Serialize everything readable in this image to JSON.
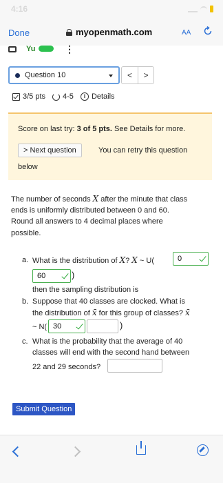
{
  "status": {
    "time": "4:16"
  },
  "browser": {
    "done": "Done",
    "url": "myopenmath.com",
    "text_size": "AA"
  },
  "toolbar": {
    "fragment": "Yu"
  },
  "nav": {
    "question": "Question 10",
    "prev": "<",
    "next": ">"
  },
  "meta": {
    "points": "3/5 pts",
    "attempts": "4-5",
    "details": "Details"
  },
  "score": {
    "prefix": "Score on last try: ",
    "value": "3 of 5 pts.",
    "suffix": " See Details for more.",
    "next_button": "> Next question",
    "retry_a": "You can retry this question",
    "retry_b": "below"
  },
  "problem": {
    "line1a": "The number of seconds ",
    "var": "X",
    "line1b": " after the minute that class",
    "line2": "ends is uniformly distributed between 0 and 60.",
    "line3": "Round all answers to 4 decimal places where",
    "line4": "possible."
  },
  "parts": {
    "a_label": "a.",
    "a_text": "What is the distribution of ",
    "a_var": "X",
    "a_q": "? ",
    "a_var2": "X",
    "a_tilde": " ~ U(",
    "a_min": "0",
    "a_max": "60",
    "a_close": ")",
    "a_after": "then the sampling distribution is",
    "b_label": "b.",
    "b_text1": "Suppose that 40 classes are clocked.  What is",
    "b_text2": "the distribution of ",
    "b_xbar": "x̄",
    "b_text3": " for this group of classes? ",
    "b_xbar2": "x̄",
    "b_tilde": "~ N(",
    "b_mean": "30",
    "b_close": ")",
    "c_label": "c.",
    "c_text1": "What is the probability that the average of 40",
    "c_text2": "classes will end with the second hand between",
    "c_text3": "22 and 29 seconds?"
  },
  "submit": "Submit Question",
  "colors": {
    "accent": "#2a6fd6",
    "submit_bg": "#2d56c4",
    "correct": "#49b04f",
    "score_bg": "#fff6dd"
  },
  "icons": [
    "lock-icon",
    "reload-icon",
    "check-icon",
    "retry-icon",
    "info-icon",
    "back-icon",
    "forward-icon",
    "share-icon",
    "compass-icon"
  ]
}
